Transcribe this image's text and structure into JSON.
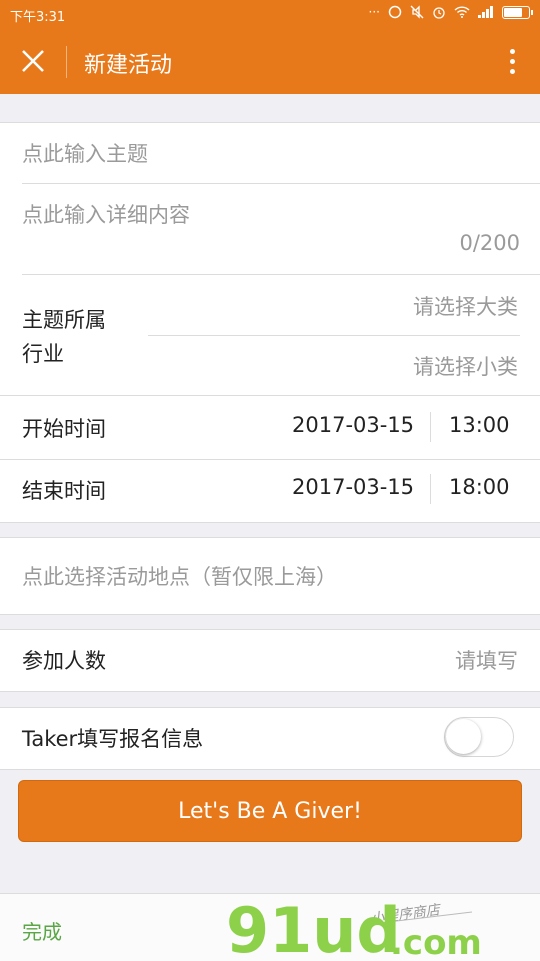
{
  "status_bar": {
    "time": "下午3:31",
    "icons": [
      "ellipsis-icon",
      "circle-icon",
      "mute-icon",
      "alarm-icon",
      "wifi-icon",
      "signal-icon",
      "battery-icon"
    ]
  },
  "app_bar": {
    "title": "新建活动",
    "close_icon": "close-icon",
    "more_icon": "more-vertical-icon"
  },
  "form": {
    "topic_placeholder": "点此输入主题",
    "detail_placeholder": "点此输入详细内容",
    "char_counter": "0/200",
    "industry_label": "主题所属\n行业",
    "industry_major_placeholder": "请选择大类",
    "industry_minor_placeholder": "请选择小类",
    "start_label": "开始时间",
    "start_date": "2017-03-15",
    "start_time": "13:00",
    "end_label": "结束时间",
    "end_date": "2017-03-15",
    "end_time": "18:00",
    "location_placeholder": "点此选择活动地点（暂仅限上海）",
    "participants_label": "参加人数",
    "participants_placeholder": "请填写",
    "taker_label": "Taker填写报名信息",
    "taker_toggle_on": false,
    "submit_label": "Let's Be A Giver!"
  },
  "bottom_bar": {
    "done_label": "完成",
    "watermark_main": "91ud",
    "watermark_domain": ".com",
    "watermark_tagline": "小程序商店"
  },
  "colors": {
    "accent": "#e8791a",
    "page_bg": "#f0eff4",
    "placeholder": "#9a9a9a",
    "done": "#5aa646",
    "watermark": "#8dd14a"
  }
}
